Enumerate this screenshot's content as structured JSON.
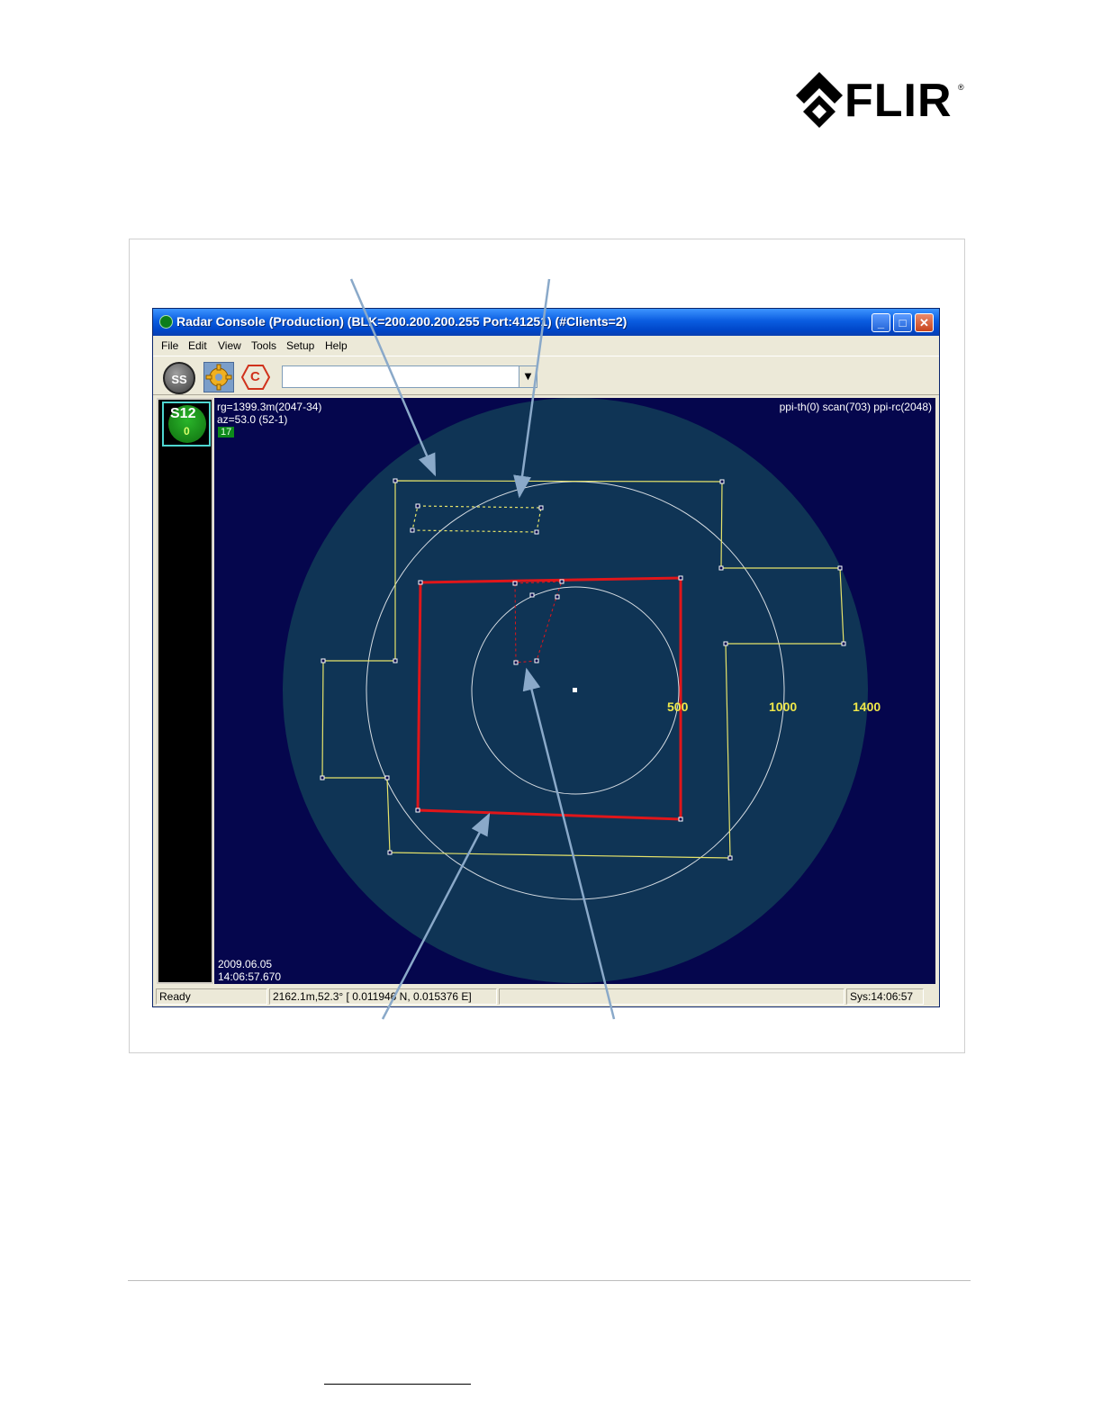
{
  "brand": {
    "name": "FLIR",
    "registered_mark": "®"
  },
  "window": {
    "title": "Radar Console (Production) (BLK=200.200.200.255 Port:41251) (#Clients=2)",
    "controls": {
      "minimize": "_",
      "maximize": "□",
      "close": "✕"
    }
  },
  "menu": [
    "File",
    "Edit",
    "View",
    "Tools",
    "Setup",
    "Help"
  ],
  "toolbar": {
    "ss_label": "SS",
    "c_label": "C",
    "combo_value": "",
    "combo_arrow": "▼"
  },
  "sidebar": {
    "sensor_label": "S12",
    "sensor_count": "0"
  },
  "radar": {
    "range_readout": "rg=1399.3m(2047-34)",
    "azimuth_readout": "az=53.0 (52-1)",
    "badge": "17",
    "scan_info": "ppi-th(0) scan(703) ppi-rc(2048)",
    "date": "2009.06.05",
    "time": "14:06:57.670",
    "range_rings": [
      "500",
      "1000",
      "1400"
    ],
    "colors": {
      "background": "#05064d",
      "sweep_disc": "#0f3455",
      "ring": "#d7dde3",
      "zone_yellow": "#e6e36a",
      "zone_red": "#e0161a"
    }
  },
  "status": {
    "state": "Ready",
    "cursor": "2162.1m,52.3° [ 0.011946 N,  0.015376 E]",
    "empty": "",
    "clock": "Sys:14:06:57"
  }
}
